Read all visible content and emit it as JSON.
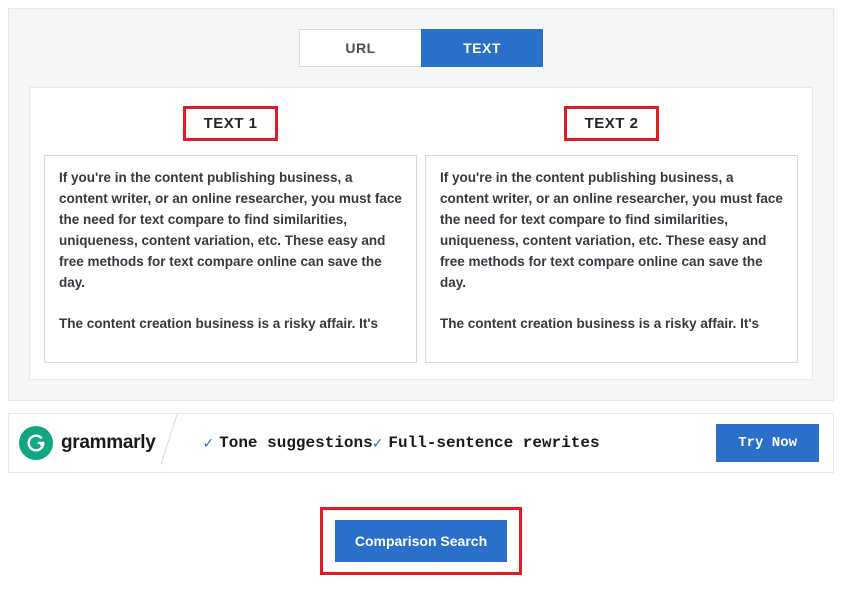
{
  "tabs": {
    "url": "URL",
    "text": "TEXT"
  },
  "columns": {
    "left": {
      "header": "TEXT 1",
      "content": "If you're in the content publishing business, a content writer, or an online researcher, you must face the need for text compare to find similarities, uniqueness, content variation, etc. These easy and free methods for text compare online can save the day.\n\nThe content creation business is a risky affair. It's"
    },
    "right": {
      "header": "TEXT 2",
      "content": "If you're in the content publishing business, a content writer, or an online researcher, you must face the need for text compare to find similarities, uniqueness, content variation, etc. These easy and free methods for text compare online can save the day.\n\nThe content creation business is a risky affair. It's"
    }
  },
  "ad": {
    "brand": "grammarly",
    "feature1": "Tone suggestions",
    "feature2": "Full-sentence rewrites",
    "cta": "Try Now"
  },
  "action": {
    "primary": "Comparison Search"
  }
}
